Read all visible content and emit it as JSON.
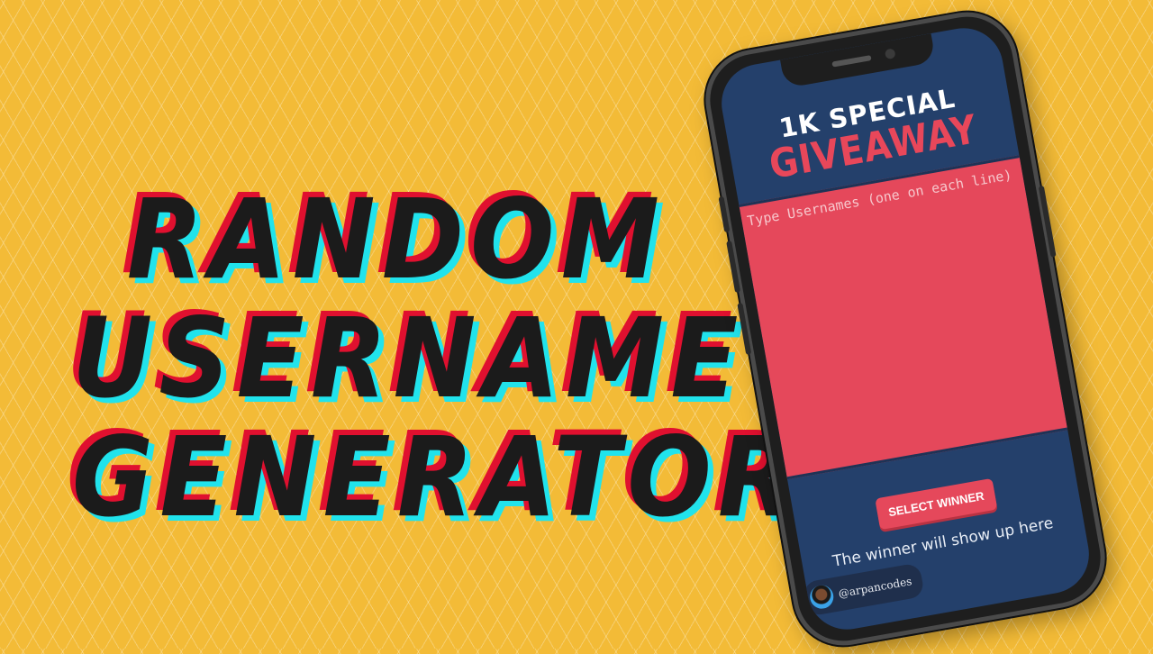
{
  "headline": {
    "line1": "RANDOM",
    "line2": "USERNAME",
    "line3": "GENERATOR"
  },
  "app": {
    "title_line1": "1K SPECIAL",
    "title_line2": "GIVEAWAY",
    "textarea_placeholder": "Type Usernames (one on each line)",
    "select_button_label": "SELECT WINNER",
    "result_text": "The winner will show up here",
    "credit_handle": "@arpancodes"
  },
  "colors": {
    "background": "#f3bb37",
    "headline_fill": "#1b1b1b",
    "headline_red_shadow": "#e0102f",
    "headline_cyan_shadow": "#21e3ec",
    "app_navy": "#24406b",
    "app_accent": "#e5485b"
  }
}
